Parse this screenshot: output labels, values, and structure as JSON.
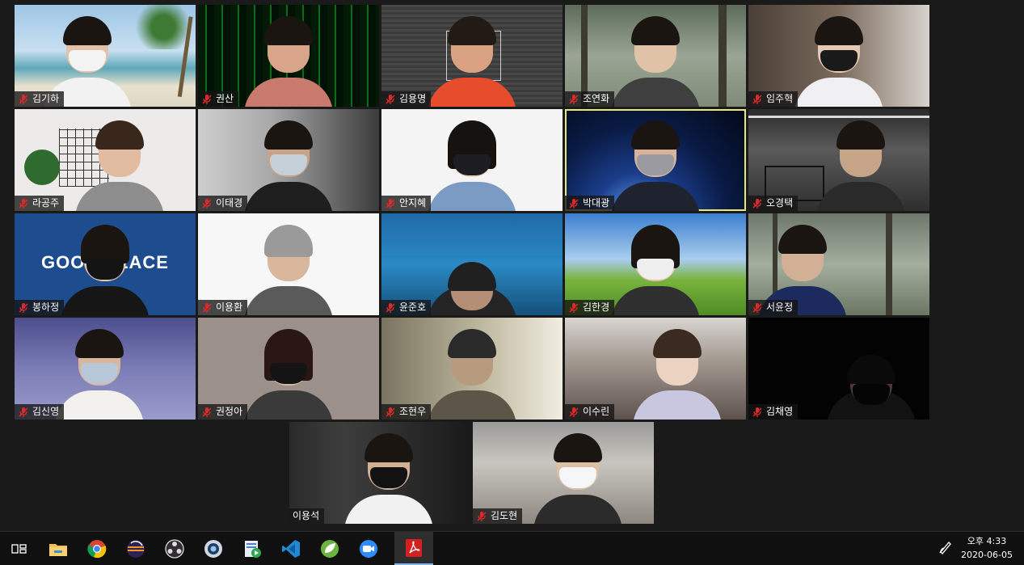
{
  "participants": [
    {
      "name": "김기하"
    },
    {
      "name": "권산"
    },
    {
      "name": "김용명"
    },
    {
      "name": "조연화"
    },
    {
      "name": "임주혁"
    },
    {
      "name": "라공주"
    },
    {
      "name": "이태경"
    },
    {
      "name": "안지혜"
    },
    {
      "name": "박대광"
    },
    {
      "name": "오경택"
    },
    {
      "name": "봉하정"
    },
    {
      "name": "이용환"
    },
    {
      "name": "윤준호"
    },
    {
      "name": "김한경"
    },
    {
      "name": "서윤정"
    },
    {
      "name": "김신영"
    },
    {
      "name": "권정아"
    },
    {
      "name": "조현우"
    },
    {
      "name": "이수린"
    },
    {
      "name": "김채영"
    },
    {
      "name": "이용석"
    },
    {
      "name": "김도현"
    }
  ],
  "background_text": {
    "good_place": "GOOD PLACE"
  },
  "muted": [
    true,
    true,
    true,
    true,
    true,
    true,
    true,
    true,
    true,
    true,
    true,
    true,
    true,
    true,
    true,
    true,
    true,
    true,
    true,
    true,
    false,
    true
  ],
  "active_speaker_index": 8,
  "taskbar": {
    "items": [
      {
        "icon": "task-view-icon"
      },
      {
        "icon": "file-explorer-icon"
      },
      {
        "icon": "chrome-icon"
      },
      {
        "icon": "eclipse-icon"
      },
      {
        "icon": "obs-icon"
      },
      {
        "icon": "camera-app-icon"
      },
      {
        "icon": "media-app-icon"
      },
      {
        "icon": "vscode-icon"
      },
      {
        "icon": "spring-tool-icon"
      },
      {
        "icon": "zoom-icon"
      },
      {
        "icon": "pdf-reader-icon"
      }
    ],
    "active_item": "pdf-reader-icon"
  },
  "clock": {
    "time": "오후 4:33",
    "date": "2020-06-05"
  },
  "colors": {
    "mute": "#e02828",
    "speaker_outline": "#e8e87a",
    "taskbar_accent": "#76b9ed"
  }
}
